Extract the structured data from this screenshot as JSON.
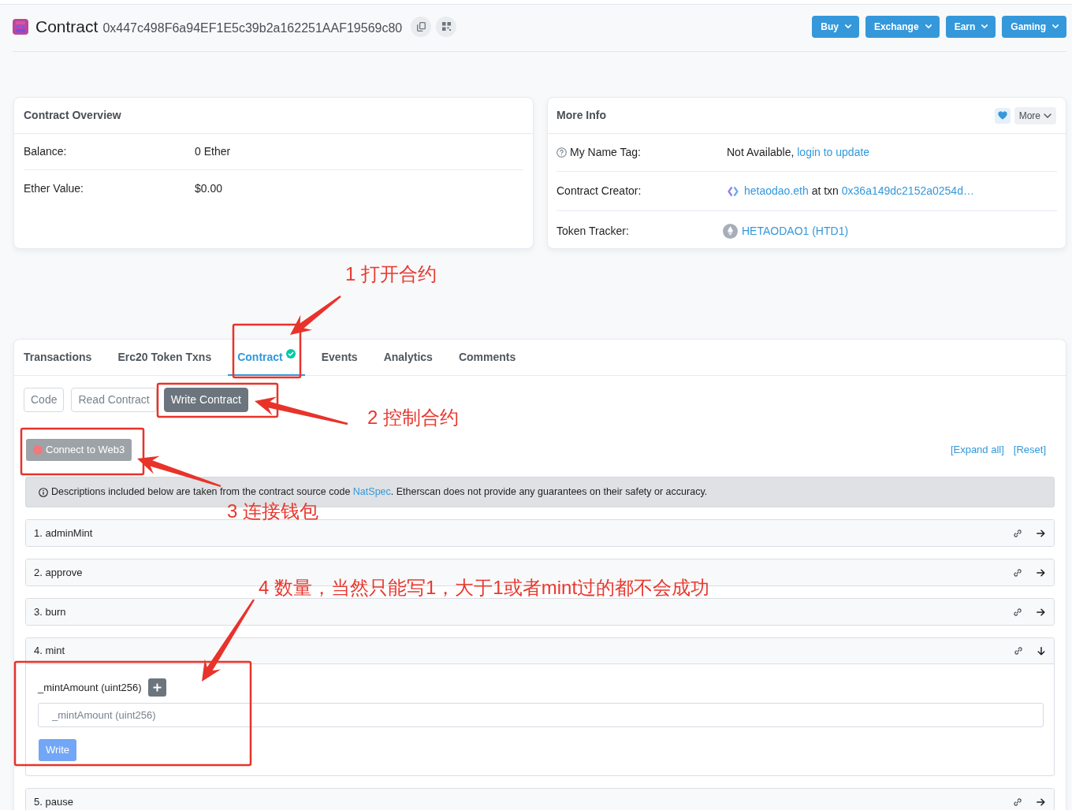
{
  "header": {
    "title": "Contract",
    "address": "0x447c498F6a94EF1E5c39b2a162251AAF19569c80",
    "menus": [
      {
        "label": "Buy"
      },
      {
        "label": "Exchange"
      },
      {
        "label": "Earn"
      },
      {
        "label": "Gaming"
      }
    ]
  },
  "overview": {
    "title": "Contract Overview",
    "rows": [
      {
        "label": "Balance:",
        "value": "0 Ether"
      },
      {
        "label": "Ether Value:",
        "value": "$0.00"
      }
    ]
  },
  "more_info": {
    "title": "More Info",
    "more_button": "More",
    "rows": [
      {
        "kind": "name_tag",
        "label": "My Name Tag:",
        "value": "Not Available,",
        "link": "login to update"
      },
      {
        "kind": "creator",
        "label": "Contract Creator:",
        "creator": "hetaodao.eth",
        "middle": "at txn",
        "txn": "0x36a149dc2152a0254d…"
      },
      {
        "kind": "token",
        "label": "Token Tracker:",
        "link": "HETAODAO1 (HTD1)"
      }
    ]
  },
  "tabs": [
    {
      "label": "Transactions",
      "selected": false,
      "verified": false
    },
    {
      "label": "Erc20 Token Txns",
      "selected": false,
      "verified": false
    },
    {
      "label": "Contract",
      "selected": true,
      "verified": true
    },
    {
      "label": "Events",
      "selected": false,
      "verified": false
    },
    {
      "label": "Analytics",
      "selected": false,
      "verified": false
    },
    {
      "label": "Comments",
      "selected": false,
      "verified": false
    }
  ],
  "sub_tabs": [
    {
      "label": "Code",
      "selected": false
    },
    {
      "label": "Read Contract",
      "selected": false
    },
    {
      "label": "Write Contract",
      "selected": true
    }
  ],
  "connect_button": {
    "label": "Connect to Web3",
    "connected": false
  },
  "panel_links": [
    {
      "label": "[Expand all]"
    },
    {
      "label": "[Reset]"
    }
  ],
  "notice": {
    "before": "Descriptions included below are taken from the contract source code",
    "link": "NatSpec",
    "after": ". Etherscan does not provide any guarantees on their safety or accuracy."
  },
  "functions": [
    {
      "label": "1. adminMint",
      "expanded": false
    },
    {
      "label": "2. approve",
      "expanded": false
    },
    {
      "label": "3. burn",
      "expanded": false
    },
    {
      "label": "4. mint",
      "expanded": true,
      "inputs": [
        {
          "label": "_mintAmount (uint256)",
          "placeholder": "_mintAmount (uint256)"
        }
      ],
      "button": "Write"
    },
    {
      "label": "5. pause",
      "expanded": false
    }
  ],
  "annotations": [
    {
      "text": "1 打开合约"
    },
    {
      "text": "2 控制合约"
    },
    {
      "text": "3 连接钱包"
    },
    {
      "text": "4 数量，当然只能写1，大于1或者mint过的都不会成功"
    }
  ]
}
